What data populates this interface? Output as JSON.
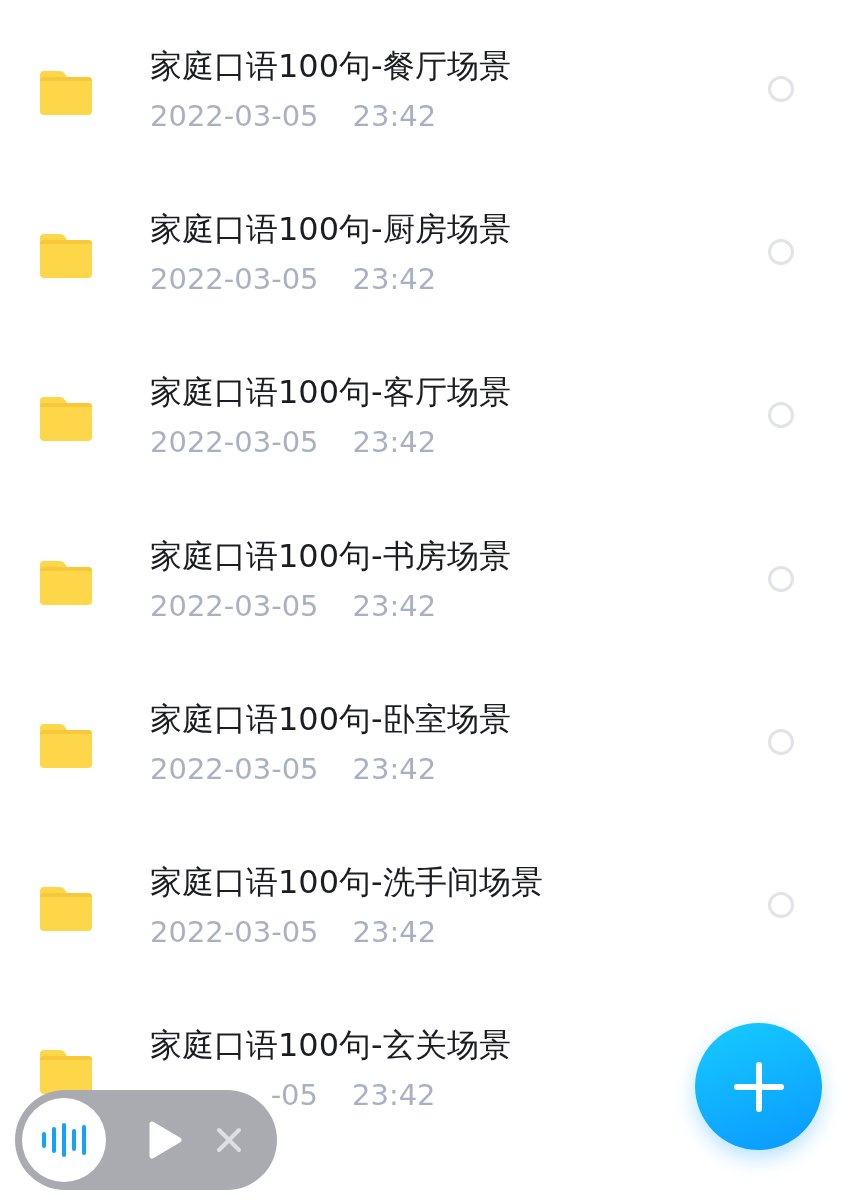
{
  "files": [
    {
      "name": "家庭口语100句-餐厅场景",
      "date": "2022-03-05",
      "time": "23:42",
      "selected": false
    },
    {
      "name": "家庭口语100句-厨房场景",
      "date": "2022-03-05",
      "time": "23:42",
      "selected": false
    },
    {
      "name": "家庭口语100句-客厅场景",
      "date": "2022-03-05",
      "time": "23:42",
      "selected": false
    },
    {
      "name": "家庭口语100句-书房场景",
      "date": "2022-03-05",
      "time": "23:42",
      "selected": false
    },
    {
      "name": "家庭口语100句-卧室场景",
      "date": "2022-03-05",
      "time": "23:42",
      "selected": false
    },
    {
      "name": "家庭口语100句-洗手间场景",
      "date": "2022-03-05",
      "time": "23:42",
      "selected": false
    },
    {
      "name": "家庭口语100句-玄关场景",
      "date": "-05",
      "time": "23:42"
    }
  ],
  "player": {
    "playing": false
  }
}
